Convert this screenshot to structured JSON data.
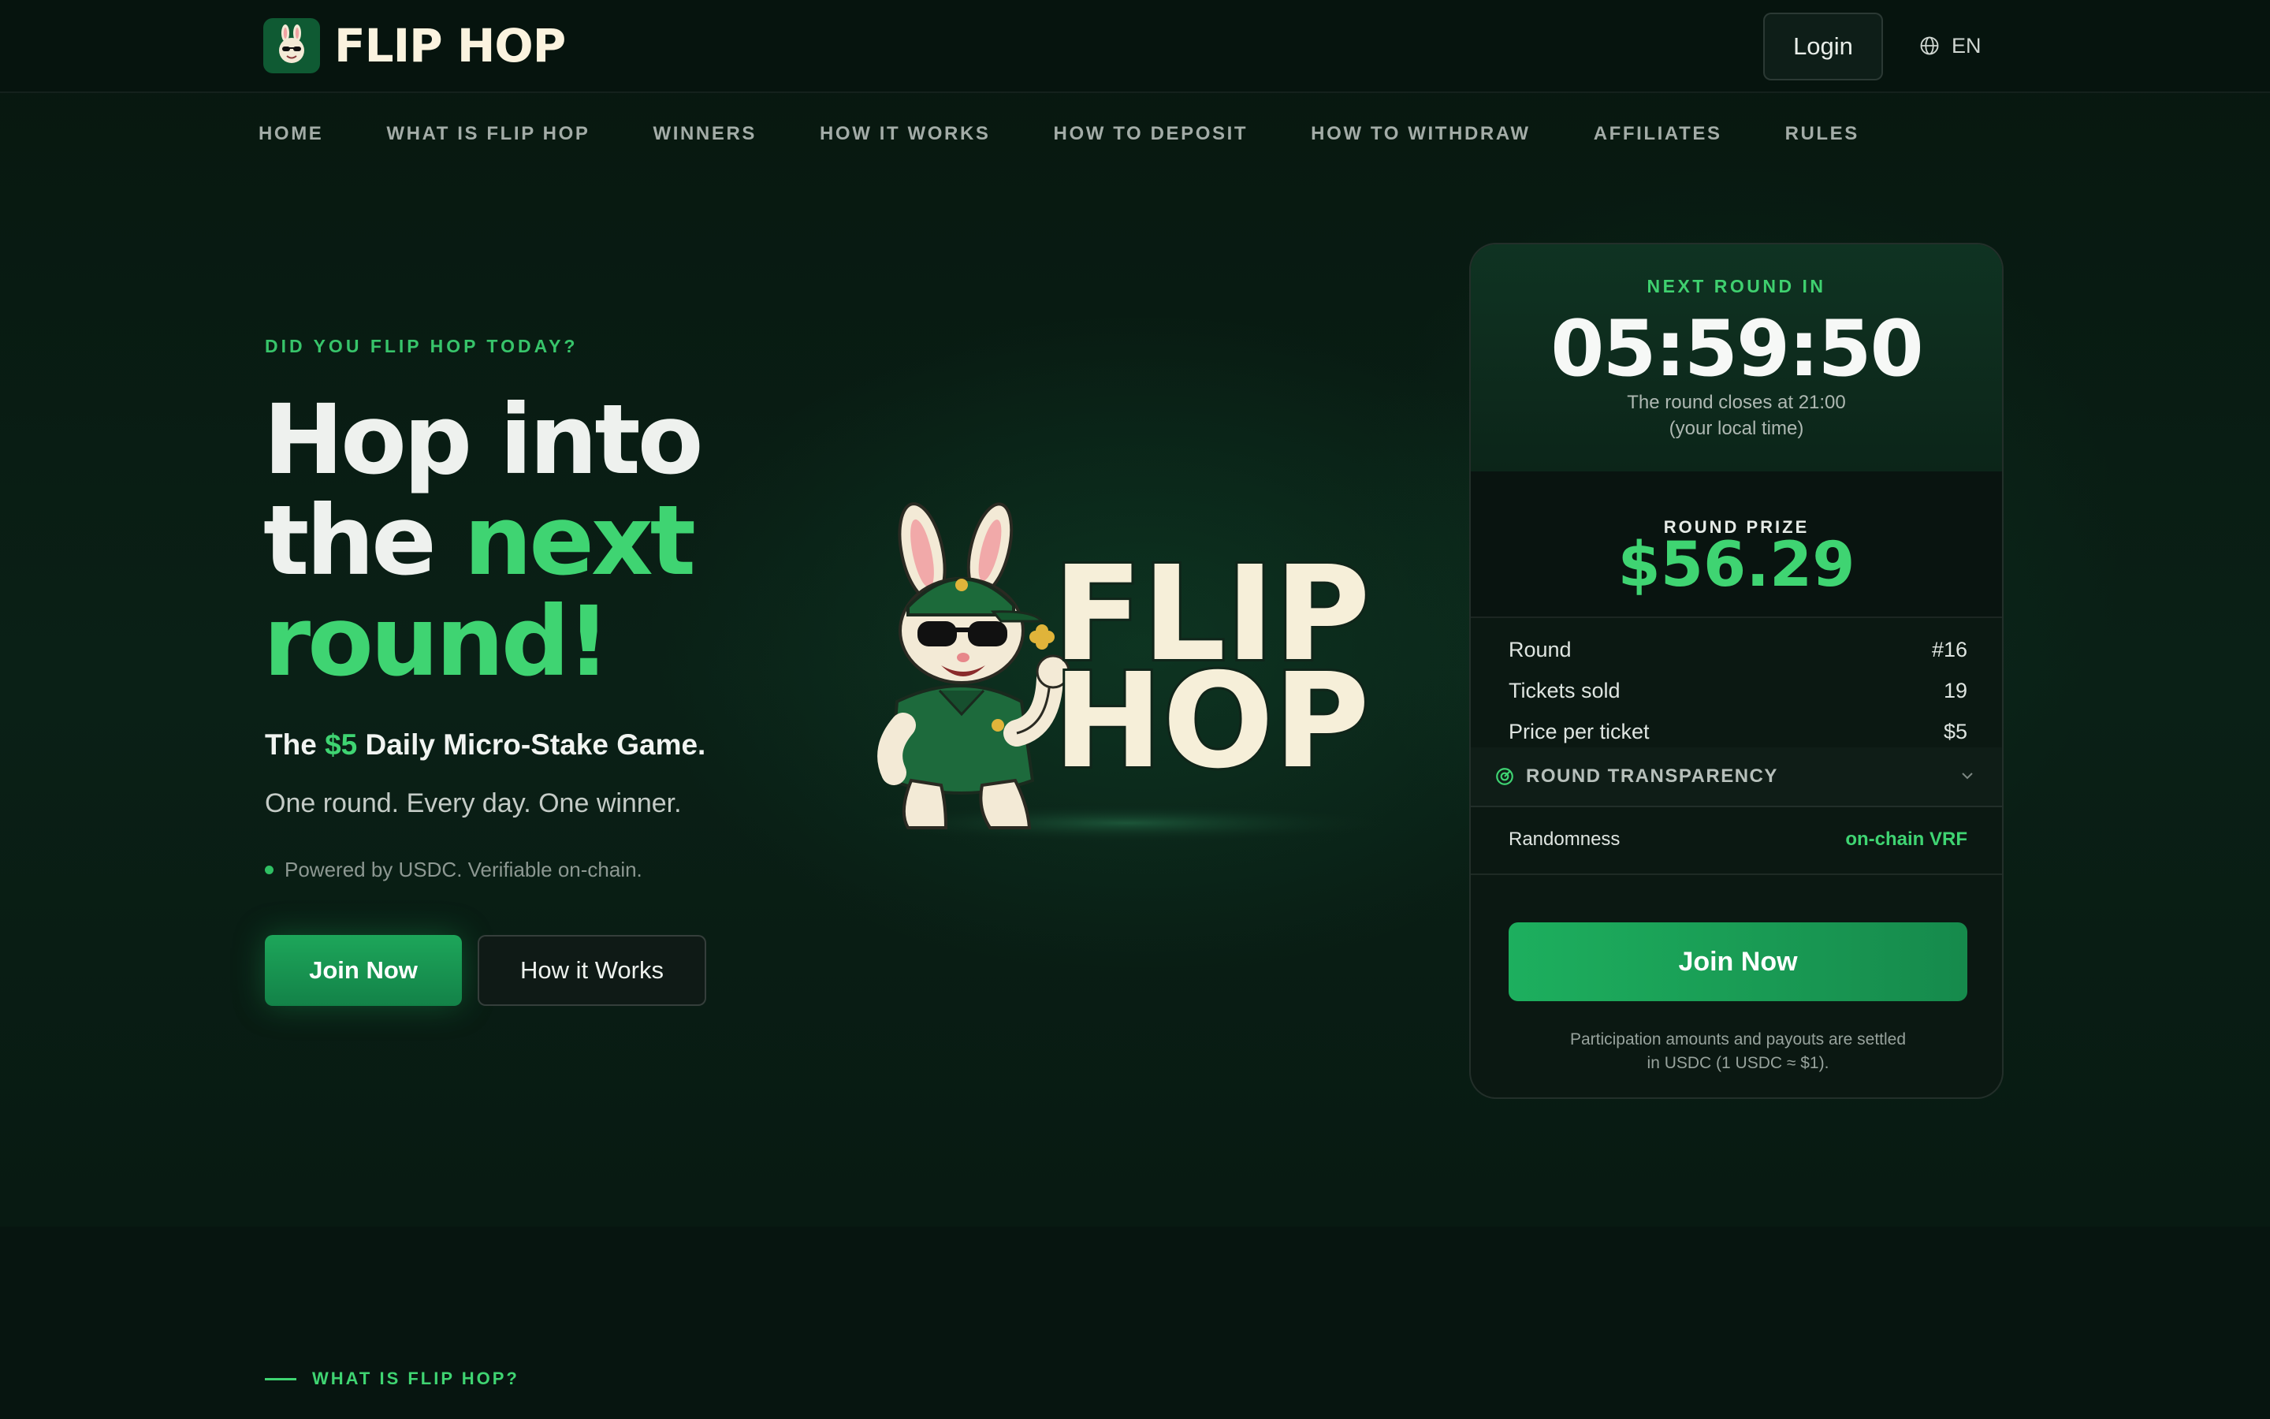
{
  "header": {
    "brand": "FLIP HOP",
    "login_label": "Login",
    "language": "EN"
  },
  "nav": {
    "items": [
      "HOME",
      "WHAT IS FLIP HOP",
      "WINNERS",
      "HOW IT WORKS",
      "HOW TO DEPOSIT",
      "HOW TO WITHDRAW",
      "AFFILIATES",
      "RULES"
    ]
  },
  "hero": {
    "eyebrow": "DID YOU FLIP HOP TODAY?",
    "headline_1": "Hop into",
    "headline_2a": "the ",
    "headline_2b": "next",
    "headline_3": "round!",
    "tagline_a": "The ",
    "tagline_price": "$5",
    "tagline_b": " Daily Micro-Stake Game.",
    "subline": "One round. Every day. One winner.",
    "powered": "Powered by USDC. Verifiable on-chain.",
    "join_label": "Join Now",
    "how_label": "How it Works"
  },
  "mascot": {
    "word_1": "FLIP",
    "word_2": "HOP"
  },
  "round_card": {
    "next_label": "NEXT ROUND IN",
    "countdown": "05:59:50",
    "closes_line1": "The round closes at 21:00",
    "closes_line2": "(your local time)",
    "prize_label": "ROUND PRIZE",
    "prize_amount": "$56.29",
    "stats": [
      {
        "label": "Round",
        "value": "#16"
      },
      {
        "label": "Tickets sold",
        "value": "19"
      },
      {
        "label": "Price per ticket",
        "value": "$5"
      }
    ],
    "transparency_label": "ROUND TRANSPARENCY",
    "randomness_label": "Randomness",
    "randomness_value": "on-chain VRF",
    "join_label": "Join Now",
    "settle_line1": "Participation amounts and payouts are settled",
    "settle_line2": "in USDC (1 USDC ≈ $1)."
  },
  "section": {
    "what_is_label": "WHAT IS FLIP HOP?"
  },
  "colors": {
    "accent": "#3fd472",
    "button": "#1da65a",
    "background": "#061410"
  }
}
